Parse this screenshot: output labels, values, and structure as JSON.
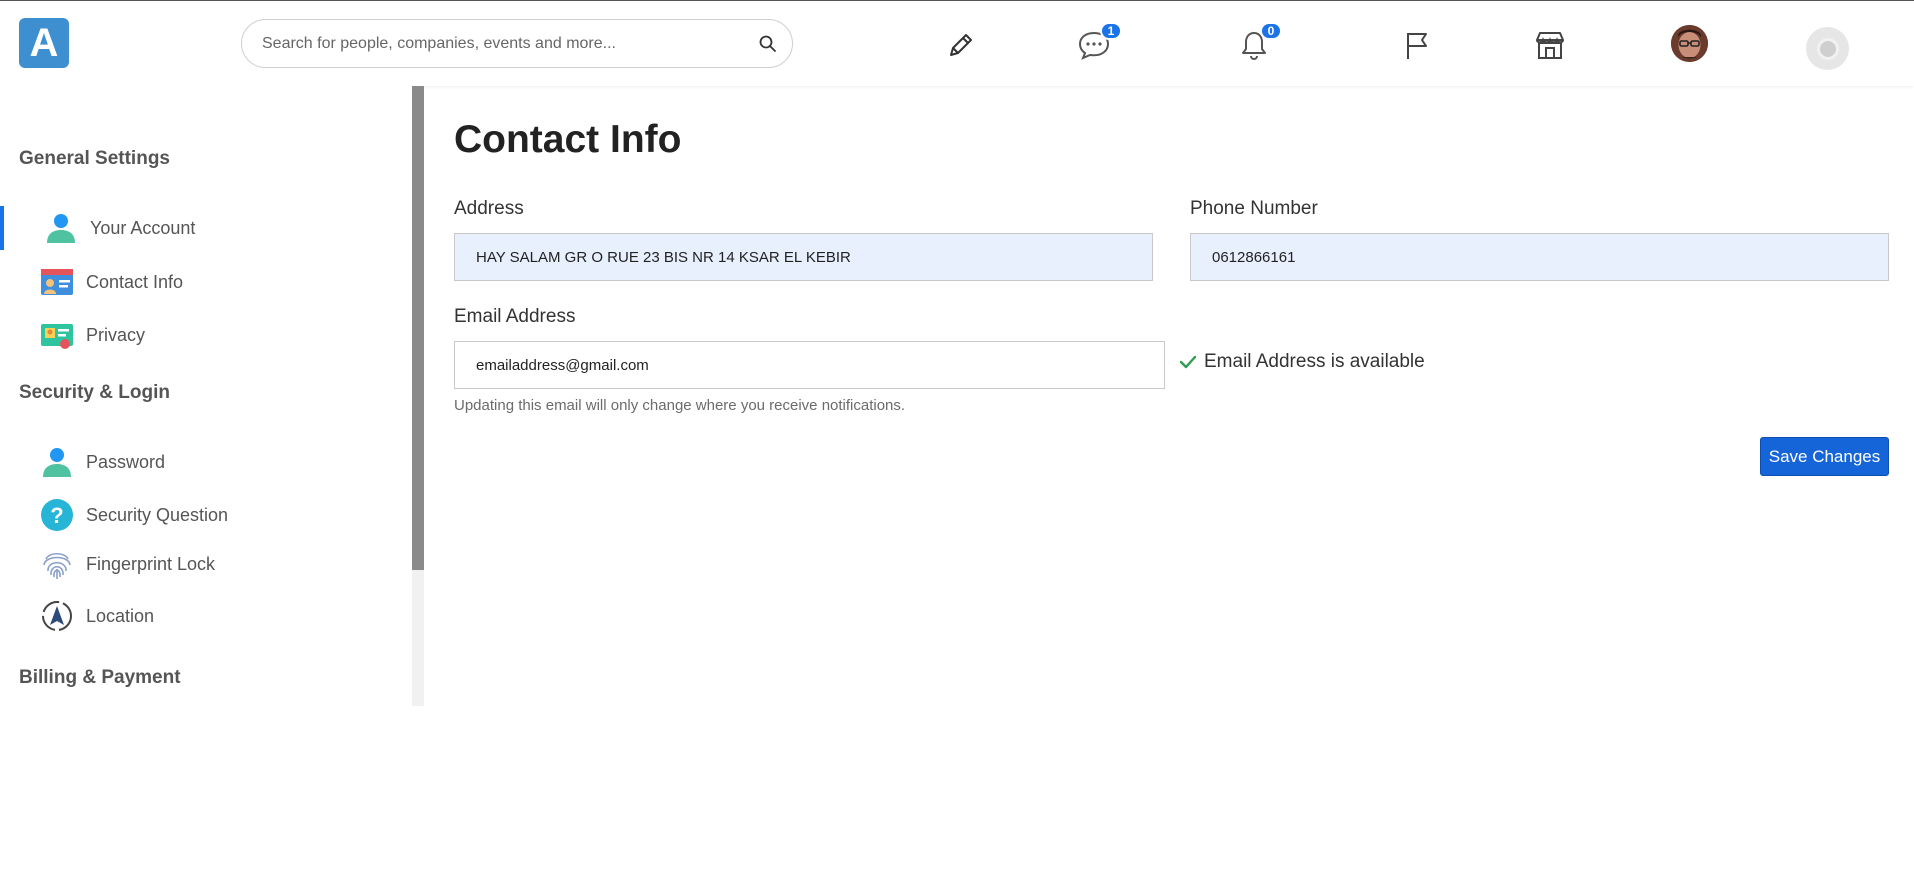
{
  "header": {
    "logo_letter": "A",
    "search_placeholder": "Search for people, companies, events and more...",
    "messages_badge": "1",
    "notifications_badge": "0"
  },
  "sidebar": {
    "sections": [
      {
        "title": "General Settings",
        "items": [
          {
            "label": "Your Account",
            "icon": "user-icon",
            "active": true
          },
          {
            "label": "Contact Info",
            "icon": "contact-card-icon"
          },
          {
            "label": "Privacy",
            "icon": "id-card-icon"
          }
        ]
      },
      {
        "title": "Security & Login",
        "items": [
          {
            "label": "Password",
            "icon": "user-icon"
          },
          {
            "label": "Security Question",
            "icon": "question-icon"
          },
          {
            "label": "Fingerprint Lock",
            "icon": "fingerprint-icon"
          },
          {
            "label": "Location",
            "icon": "location-compass-icon"
          }
        ]
      },
      {
        "title": "Billing & Payment",
        "items": []
      }
    ]
  },
  "main": {
    "title": "Contact Info",
    "address_label": "Address",
    "address_value": "HAY SALAM GR O RUE 23 BIS NR 14 KSAR EL KEBIR",
    "phone_label": "Phone Number",
    "phone_value": "0612866161",
    "email_label": "Email Address",
    "email_value": "emailaddress@gmail.com",
    "email_status": "Email Address is available",
    "email_hint": "Updating this email will only change where you receive notifications.",
    "save_label": "Save Changes"
  },
  "colors": {
    "accent": "#1565d8",
    "logo": "#3d8fd0",
    "success": "#2e9d4f",
    "input_filled_bg": "#e8f0fe"
  }
}
